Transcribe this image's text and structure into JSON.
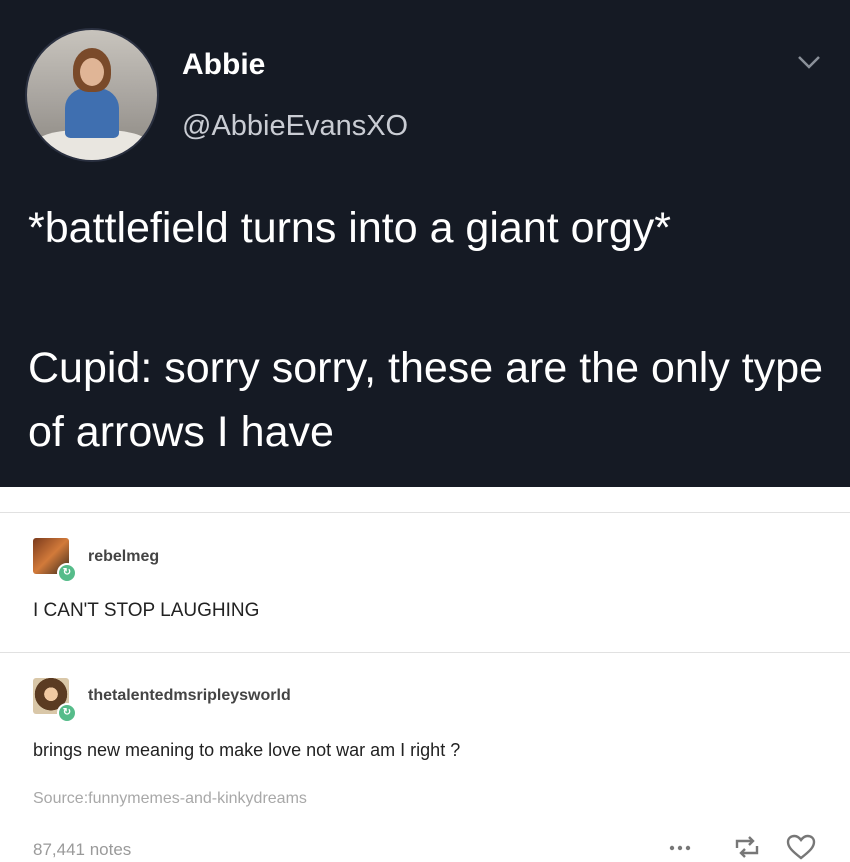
{
  "tweet": {
    "author_name": "Abbie",
    "author_handle": "@AbbieEvansXO",
    "line1": "*battlefield turns into a giant orgy*",
    "line2": "Cupid: sorry sorry, these are the only type of arrows I have"
  },
  "reblogs": [
    {
      "username": "rebelmeg",
      "text": "I CAN'T STOP LAUGHING"
    },
    {
      "username": "thetalentedmsripleysworld",
      "text": "brings new meaning to make love not war am I right ?"
    }
  ],
  "source": "Source:funnymemes-and-kinkydreams",
  "footer": {
    "notes": "87,441 notes",
    "more_icon": "ellipsis-icon",
    "reblog_icon": "reblog-icon",
    "like_icon": "heart-icon"
  },
  "colors": {
    "tweet_bg": "#151a24",
    "badge_green": "#56bc8a"
  }
}
